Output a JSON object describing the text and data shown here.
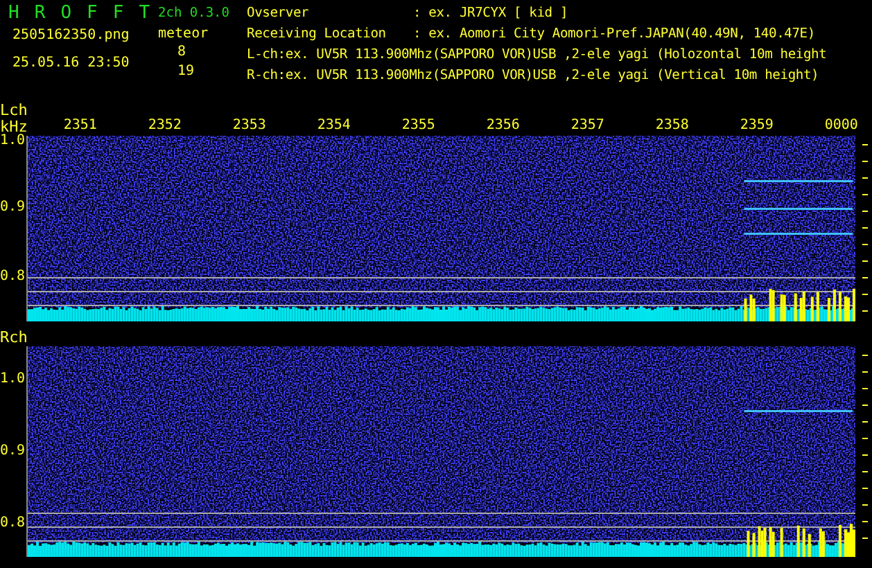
{
  "header": {
    "title_letters": "H R O F F T",
    "version": "2ch 0.3.0",
    "filename": "2505162350.png",
    "timestamp": "25.05.16 23:50",
    "meteor_label": "meteor",
    "meteor_counts": [
      "8",
      "19"
    ]
  },
  "info": [
    {
      "kind": "field",
      "label": "Ovserver",
      "value": ": ex. JR7CYX [ kid ]"
    },
    {
      "kind": "field",
      "label": "Receiving Location",
      "value": ": ex. Aomori City Aomori-Pref.JAPAN(40.49N, 140.47E)"
    },
    {
      "kind": "line",
      "text": "L-ch:ex. UV5R 113.900Mhz(SAPPORO VOR)USB ,2-ele yagi (Holozontal 10m height"
    },
    {
      "kind": "line",
      "text": "R-ch:ex. UV5R 113.900Mhz(SAPPORO VOR)USB ,2-ele yagi (Vertical 10m height)"
    }
  ],
  "time_axis": [
    "2351",
    "2352",
    "2353",
    "2354",
    "2355",
    "2356",
    "2357",
    "2358",
    "2359",
    "0000"
  ],
  "channels": [
    {
      "name": "Lch",
      "unit": "kHz",
      "ticks": [
        "1.0",
        "0.9",
        "0.8"
      ]
    },
    {
      "name": "Rch",
      "ticks": [
        "1.0",
        "0.9",
        "0.8"
      ]
    }
  ]
}
